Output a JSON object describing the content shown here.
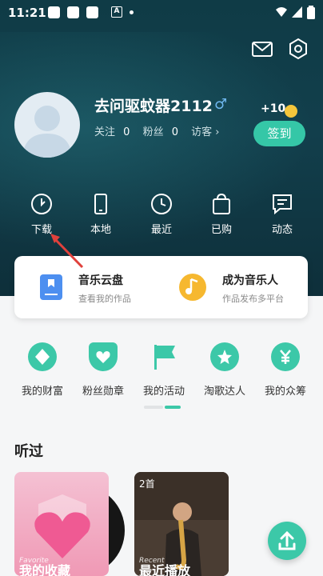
{
  "status": {
    "time": "11:21",
    "a_badge": "A"
  },
  "header": {
    "mail_icon": "mail-icon",
    "settings_icon": "gear-icon"
  },
  "profile": {
    "username": "去问驱蚊器2112",
    "gender_symbol": "♂",
    "follow_label": "关注",
    "follow_count": "0",
    "fans_label": "粉丝",
    "fans_count": "0",
    "visitors_label": "访客 ›",
    "coin_text": "+10",
    "signin_label": "签到"
  },
  "quick_actions": [
    {
      "label": "下载",
      "icon": "download-icon"
    },
    {
      "label": "本地",
      "icon": "phone-icon"
    },
    {
      "label": "最近",
      "icon": "clock-icon"
    },
    {
      "label": "已购",
      "icon": "bag-icon"
    },
    {
      "label": "动态",
      "icon": "message-icon"
    }
  ],
  "card": {
    "left_title": "音乐云盘",
    "left_sub": "查看我的作品",
    "right_title": "成为音乐人",
    "right_sub": "作品发布多平台"
  },
  "features": [
    {
      "label": "我的财富",
      "icon": "diamond-icon"
    },
    {
      "label": "粉丝勋章",
      "icon": "heart-badge-icon"
    },
    {
      "label": "我的活动",
      "icon": "flag-icon"
    },
    {
      "label": "淘歌达人",
      "icon": "star-icon"
    },
    {
      "label": "我的众筹",
      "icon": "yuan-icon"
    }
  ],
  "history": {
    "title": "听过",
    "playlist1": {
      "sub": "Favorite",
      "name": "我的收藏"
    },
    "playlist2": {
      "count": "2首",
      "sub": "Recent",
      "name": "最近播放"
    }
  },
  "colors": {
    "accent": "#35c7a7",
    "hero": "#123f4c",
    "arrow": "#e0413c"
  }
}
